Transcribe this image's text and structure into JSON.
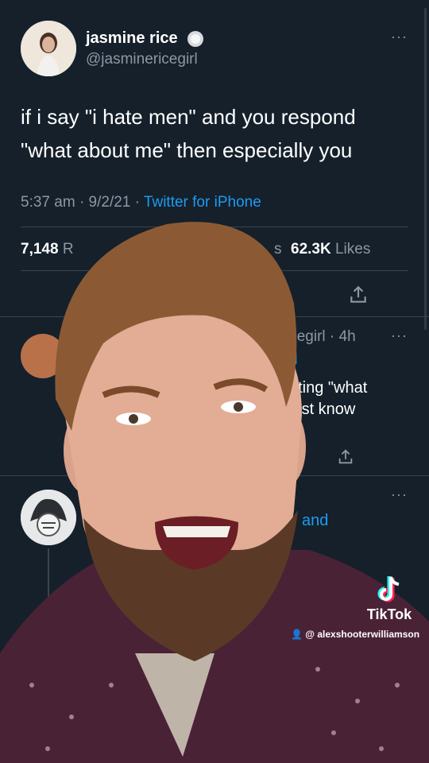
{
  "tweet": {
    "author_name": "jasmine rice",
    "author_handle": "@jasminericegirl",
    "text_line1": "if i say \"i hate men\" and you respond",
    "text_line2": "\"what about me\" then especially you",
    "time": "5:37 am",
    "date": "9/2/21",
    "sep": "·",
    "client": "Twitter for iPhone",
    "retweets_count": "7,148",
    "retweets_label_partial": "R",
    "quote_label_partial": "s",
    "likes_count": "62.3K",
    "likes_label": "Likes",
    "more_glyph": "···"
  },
  "reply1": {
    "handle_partial": "icegirl",
    "age": "4h",
    "more_glyph": "···",
    "replying_partial": "rl",
    "text_line1_partial": "nting \"what",
    "text_line2_partial": "just know"
  },
  "reply2": {
    "more_glyph": "···",
    "text_partial": "and"
  },
  "watermark": {
    "brand": "TikTok",
    "username": "@ alexshooterwilliamson"
  },
  "colors": {
    "background": "#15202b",
    "link": "#1d9bf0",
    "muted": "#8b98a5",
    "shirt": "#4a2236"
  }
}
